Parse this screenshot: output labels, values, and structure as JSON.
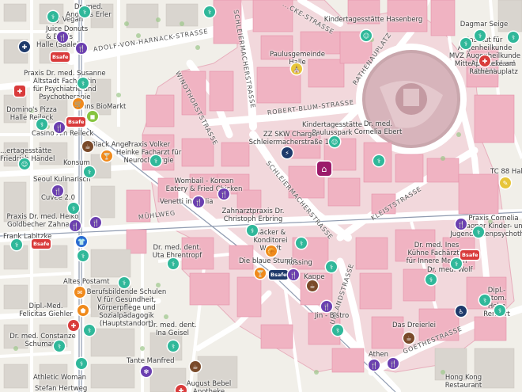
{
  "map": {
    "colors": {
      "building": "#f0b3c2",
      "building_edge": "#e38aa3",
      "zone_outline": "#e07a98",
      "road": "#ffffff",
      "tram": "#9aa6b8",
      "background": "#f1efe9"
    },
    "streets": {
      "harnack": "ADOLF-VON-HARNACK-STRASSE",
      "windthorst": "WINDTHORSTSTRASSE",
      "schleiermacher_top": "SCHLEIERMACHERSTRASSE",
      "schleiermacher_mid": "SCHLEIERMACHERSTRASSE",
      "blum": "ROBERT-BLUM-STRASSE",
      "rathenau": "RATHENAUPLATZ",
      "klei": "KLEISTSTRASSE",
      "uhland": "UHLANDSTRASSE",
      "muehlweg": "MÜHLWEG",
      "goethe": "GOETHESTRASSE",
      "top_strasse": "...CKE-STRASSE"
    },
    "labels": {
      "kita_haus": "Kindertagesstätte Hasenberg",
      "dagmar": "Dagmar Seige",
      "institut": "Institut für Augenheilkunde\nMVZ Augenheilkunde\nMitteldeutschland GmbH",
      "apotheke_rathenau": "Apotheke am\nRathenauplatz",
      "paulusgemeinde": "Paulusgemeinde\nHalle",
      "kita_paulus": "Kindertagesstätte\nPaulusspark",
      "zzsw": "ZZ SKW Charger\nSchleiermacherstraße 11",
      "ebert": "Dr. med.\nCornelia Ebert",
      "tc88": "TC 88 Halle",
      "volker": "Praxis Volker\nHeinke Facharzt für\nNeurochirurgie",
      "wombail": "Wombail - Korean\nEatery & Fried Chicken",
      "venetti": "Venetti in Giulia",
      "zahnarzt": "Zahnarztpraxis Dr.\nChristoph Erbring",
      "backer": "Bäcker &\nKonditorei\nWendt",
      "utz": "Dr. med. dent.\nUta Ehrentropf",
      "blaue_stunde": "Die blaue Stunde",
      "rossing": "Rossing",
      "kappe": "Kappe",
      "kuehne": "Dr. med. Ines\nKühne Fachärztin\nfür Innere Medizin",
      "wolf": "Dr. med. Wolf",
      "cornelia_k": "Praxis Cornelia\nWagner Kinder- und\nJugendlichenpsychother...",
      "holm": "Dipl.-Stom.\nHolm Rennert",
      "bistro": "Jin - Bistro",
      "dreierlei": "Das Dreierlei",
      "athen": "Athen",
      "hongkong": "Hong Kong\nRestaurant",
      "august": "August Bebel\nApotheke",
      "tante": "Tante Manfred",
      "ina": "Dr. med. dent.\nIna Geisel",
      "berufsbild": "Berufsbildende Schulen\nV für Gesundheit,\nKörperpflege und\nSozialpädagogik\n(Hauptstandort)",
      "altes_postamt": "Altes Postamt",
      "felicitas": "Dipl.-Med.\nFelicitas Giehler",
      "constanze": "Dr. med. Constanze\nSchumann",
      "athletic": "Athletic Woman",
      "hertweg": "Stefan Hertweg",
      "frank": "Frank Labitzke",
      "heiko": "Praxis Dr. med. Heiko\nGoldbecher Zahnarzt",
      "cuvee": "Cuvee 2.0",
      "seoul": "Seoul Kulinarisch",
      "kita_handel": "...ertagesstätte\nFriedrich Händel",
      "casino": "Casino Am Reileck",
      "dominos": "Domino's Pizza\nHalle Reileck",
      "susanne": "Praxis Dr. med. Susanne\nAltstadt Fachärztin\nfür Psychiatrie und\nPsychotherapie",
      "denns": "Denns BioMarkt",
      "black_angel": "Black Angel",
      "konsum": "Konsum",
      "bay_vegan": "Bay Vegan",
      "juice": "Juice Donuts\n& Bowls",
      "halle_saale": "Halle (Saale)",
      "andreas": "Dr. med.\nAndreas Erler"
    },
    "poi_badge_text": "Bsafe"
  }
}
